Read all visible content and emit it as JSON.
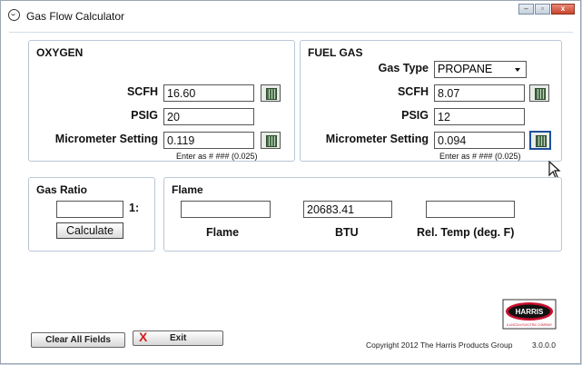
{
  "window": {
    "title": "Gas Flow Calculator",
    "controls": [
      "minimize",
      "maximize",
      "close"
    ],
    "close_glyph": "x"
  },
  "oxygen": {
    "title": "OXYGEN",
    "scfh_label": "SCFH",
    "scfh_value": "16.60",
    "psig_label": "PSIG",
    "psig_value": "20",
    "micrometer_label": "Micrometer Setting",
    "micrometer_value": "0.119",
    "hint": "Enter as # ### (0.025)"
  },
  "fuel": {
    "title": "FUEL GAS",
    "gas_type_label": "Gas Type",
    "gas_type_value": "PROPANE",
    "scfh_label": "SCFH",
    "scfh_value": "8.07",
    "psig_label": "PSIG",
    "psig_value": "12",
    "micrometer_label": "Micrometer Setting",
    "micrometer_value": "0.094",
    "hint": "Enter as # ### (0.025)"
  },
  "gas_ratio": {
    "title": "Gas Ratio",
    "value": "",
    "suffix": "1:",
    "calculate_label": "Calculate"
  },
  "flame": {
    "title": "Flame",
    "flame_value": "",
    "flame_label": "Flame",
    "btu_value": "20683.41",
    "btu_label": "BTU",
    "rel_temp_value": "",
    "rel_temp_label": "Rel. Temp (deg. F)"
  },
  "footer": {
    "clear_label": "Clear All Fields",
    "exit_label": "Exit",
    "exit_glyph": "X",
    "copyright": "Copyright 2012 The Harris Products Group",
    "version": "3.0.0.0",
    "logo_text": "HARRIS",
    "logo_subtext": "A LINCOLN ELECTRIC COMPANY"
  },
  "icons": [
    "app-icon",
    "calculator-icon",
    "mouse-cursor-icon",
    "harris-logo"
  ],
  "colors": {
    "panel_border": "#b9c7d6",
    "exit_x": "#d01f1f",
    "logo_red": "#c8102e"
  }
}
